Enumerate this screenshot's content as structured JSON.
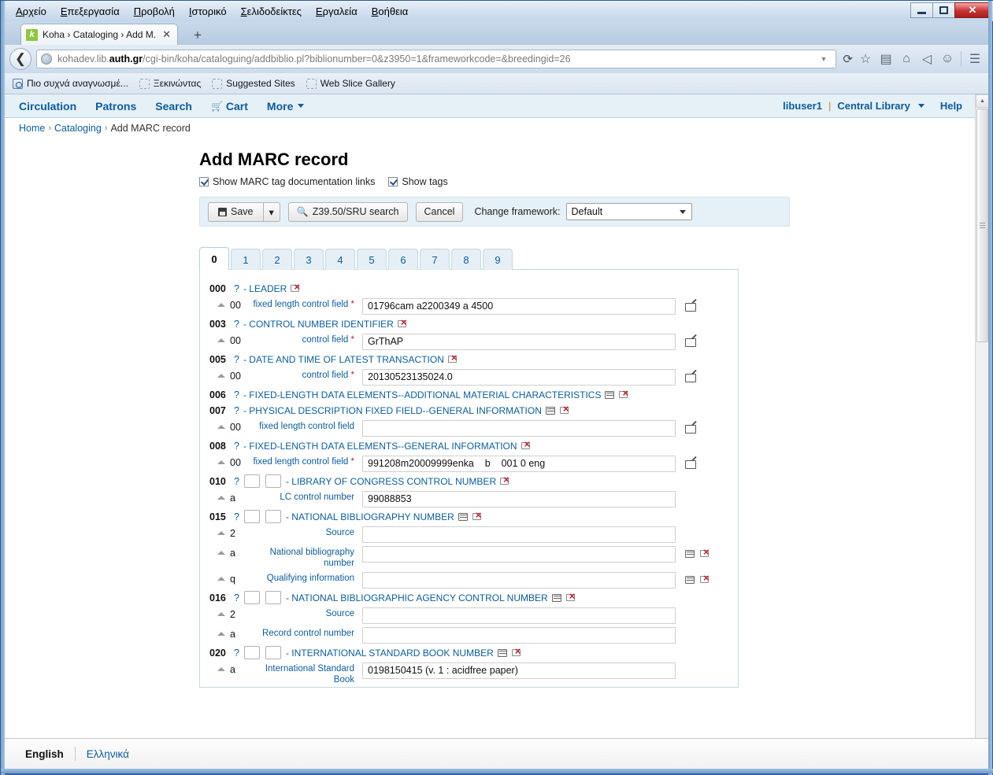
{
  "window": {
    "menu": [
      "Αρχείο",
      "Επεξεργασία",
      "Προβολή",
      "Ιστορικό",
      "Σελιδοδείκτες",
      "Εργαλεία",
      "Βοήθεια"
    ],
    "minimize_label": "–",
    "maximize_label": "□",
    "close_label": "✕"
  },
  "browser": {
    "tab_title": "Koha › Cataloging › Add M...",
    "tab_close": "✕",
    "new_tab": "+",
    "back": "❮",
    "url_host": "kohadev.lib.",
    "url_domain": "auth.gr",
    "url_path": "/cgi-bin/koha/cataloguing/addbiblio.pl?biblionumber=0&z3950=1&frameworkcode=&breedingid=26",
    "url_dropdown": "▼",
    "reload": "⟳",
    "toolbar_icons": [
      "bookmark-star-icon",
      "reading-list-icon",
      "home-icon",
      "send-tab-icon",
      "feedback-smiley-icon",
      "menu-hamburger-icon"
    ],
    "bookmarks": [
      {
        "label": "Πιο συχνά αναγνωσμέ...",
        "icon": "most-visited-icon"
      },
      {
        "label": "Ξεκινώντας",
        "icon": "bookmark-folder-icon"
      },
      {
        "label": "Suggested Sites",
        "icon": "bookmark-folder-icon"
      },
      {
        "label": "Web Slice Gallery",
        "icon": "bookmark-folder-icon"
      }
    ]
  },
  "koha": {
    "nav": [
      {
        "label": "Circulation"
      },
      {
        "label": "Patrons"
      },
      {
        "label": "Search"
      },
      {
        "label": "Cart",
        "icon": "cart-icon"
      },
      {
        "label": "More",
        "icon": "chevron-down-icon"
      }
    ],
    "user": "libuser1",
    "divider": "|",
    "library": "Central Library",
    "help": "Help",
    "breadcrumb": {
      "home": "Home",
      "sep": "›",
      "section": "Cataloging",
      "current": "Add MARC record"
    }
  },
  "main": {
    "title": "Add MARC record",
    "checkboxes": [
      {
        "label": "Show MARC tag documentation links",
        "checked": true
      },
      {
        "label": "Show tags",
        "checked": true
      }
    ],
    "toolbar": {
      "save_label": "Save",
      "save_caret": "▾",
      "z3950_label": "Z39.50/SRU search",
      "cancel_label": "Cancel",
      "framework_label": "Change framework:",
      "framework_value": "Default"
    },
    "tabs": [
      "0",
      "1",
      "2",
      "3",
      "4",
      "5",
      "6",
      "7",
      "8",
      "9"
    ],
    "active_tab": "0"
  },
  "marc_fields": [
    {
      "tag": "000",
      "help": "?",
      "dash": "-",
      "name": "LEADER",
      "indicators": false,
      "clone": false,
      "delete": true,
      "subfields": [
        {
          "code": "00",
          "label": "fixed length control field",
          "required": true,
          "value": "01796cam a2200349 a 4500",
          "edit": true,
          "clone": false,
          "delete": false
        }
      ]
    },
    {
      "tag": "003",
      "help": "?",
      "dash": "-",
      "name": "CONTROL NUMBER IDENTIFIER",
      "indicators": false,
      "clone": false,
      "delete": true,
      "subfields": [
        {
          "code": "00",
          "label": "control field",
          "required": true,
          "value": "GrThAP",
          "edit": true,
          "clone": false,
          "delete": false
        }
      ]
    },
    {
      "tag": "005",
      "help": "?",
      "dash": "-",
      "name": "DATE AND TIME OF LATEST TRANSACTION",
      "indicators": false,
      "clone": false,
      "delete": true,
      "subfields": [
        {
          "code": "00",
          "label": "control field",
          "required": true,
          "value": "20130523135024.0",
          "edit": true,
          "clone": false,
          "delete": false
        }
      ]
    },
    {
      "tag": "006",
      "help": "?",
      "dash": "-",
      "name": "FIXED-LENGTH DATA ELEMENTS--ADDITIONAL MATERIAL CHARACTERISTICS",
      "indicators": false,
      "clone": true,
      "delete": true,
      "subfields": []
    },
    {
      "tag": "007",
      "help": "?",
      "dash": "-",
      "name": "PHYSICAL DESCRIPTION FIXED FIELD--GENERAL INFORMATION",
      "indicators": false,
      "clone": true,
      "delete": true,
      "subfields": [
        {
          "code": "00",
          "label": "fixed length control field",
          "required": false,
          "value": "",
          "edit": true,
          "clone": false,
          "delete": false
        }
      ]
    },
    {
      "tag": "008",
      "help": "?",
      "dash": "-",
      "name": "FIXED-LENGTH DATA ELEMENTS--GENERAL INFORMATION",
      "indicators": false,
      "clone": false,
      "delete": true,
      "subfields": [
        {
          "code": "00",
          "label": "fixed length control field",
          "required": true,
          "value": "991208m20009999enka    b    001 0 eng",
          "edit": true,
          "clone": false,
          "delete": false
        }
      ]
    },
    {
      "tag": "010",
      "help": "?",
      "dash": "-",
      "name": "LIBRARY OF CONGRESS CONTROL NUMBER",
      "indicators": true,
      "clone": false,
      "delete": true,
      "subfields": [
        {
          "code": "a",
          "label": "LC control number",
          "required": false,
          "value": "99088853",
          "edit": false,
          "clone": false,
          "delete": false
        }
      ]
    },
    {
      "tag": "015",
      "help": "?",
      "dash": "-",
      "name": "NATIONAL BIBLIOGRAPHY NUMBER",
      "indicators": true,
      "clone": true,
      "delete": true,
      "subfields": [
        {
          "code": "2",
          "label": "Source",
          "required": false,
          "value": "",
          "edit": false,
          "clone": false,
          "delete": false
        },
        {
          "code": "a",
          "label": "National bibliography number",
          "required": false,
          "value": "",
          "edit": false,
          "clone": true,
          "delete": true
        },
        {
          "code": "q",
          "label": "Qualifying information",
          "required": false,
          "value": "",
          "edit": false,
          "clone": true,
          "delete": true
        }
      ]
    },
    {
      "tag": "016",
      "help": "?",
      "dash": "-",
      "name": "NATIONAL BIBLIOGRAPHIC AGENCY CONTROL NUMBER",
      "indicators": true,
      "clone": true,
      "delete": true,
      "subfields": [
        {
          "code": "2",
          "label": "Source",
          "required": false,
          "value": "",
          "edit": false,
          "clone": false,
          "delete": false
        },
        {
          "code": "a",
          "label": "Record control number",
          "required": false,
          "value": "",
          "edit": false,
          "clone": false,
          "delete": false
        }
      ]
    },
    {
      "tag": "020",
      "help": "?",
      "dash": "-",
      "name": "INTERNATIONAL STANDARD BOOK NUMBER",
      "indicators": true,
      "clone": true,
      "delete": true,
      "subfields": [
        {
          "code": "a",
          "label": "International Standard Book",
          "required": false,
          "value": "0198150415 (v. 1 : acidfree paper)",
          "edit": false,
          "clone": false,
          "delete": false
        }
      ]
    }
  ],
  "footer": {
    "lang_english": "English",
    "lang_greek": "Ελληνικά"
  }
}
